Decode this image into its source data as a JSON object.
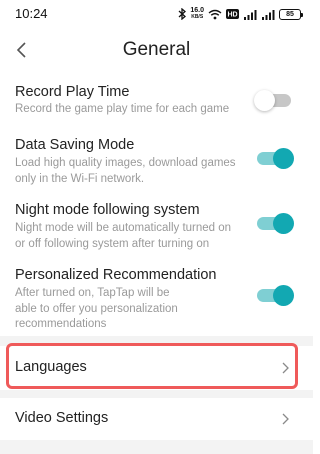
{
  "status_bar": {
    "time": "10:24",
    "speed_value": "16.0",
    "speed_unit": "KB/S",
    "battery_level": "85",
    "icons": [
      "bluetooth-icon",
      "wifi-icon",
      "hd-icon",
      "signal-icon",
      "signal-icon",
      "battery-icon"
    ]
  },
  "header": {
    "title": "General",
    "back_icon": "chevron-left-icon"
  },
  "settings": [
    {
      "title": "Record Play Time",
      "description": "Record the game play time for each game",
      "enabled": false
    },
    {
      "title": "Data Saving Mode",
      "description": "Load high quality images, download games only in the Wi-Fi network.",
      "enabled": true
    },
    {
      "title": "Night mode following system",
      "description": "Night mode will be automatically turned on or off following system after turning on",
      "enabled": true
    },
    {
      "title": "Personalized Recommendation",
      "description": "After turned on, TapTap will be able to offer you personalization recommendations",
      "enabled": true
    }
  ],
  "nav_items": [
    {
      "label": "Languages",
      "icon": "chevron-right-icon",
      "highlighted": true
    },
    {
      "label": "Video Settings",
      "icon": "chevron-right-icon",
      "highlighted": false
    }
  ],
  "colors": {
    "accent": "#12a8b2",
    "accent_track": "#7fcfd3",
    "highlight_border": "#ef5a5a",
    "section_bg": "#f3f3f3"
  }
}
